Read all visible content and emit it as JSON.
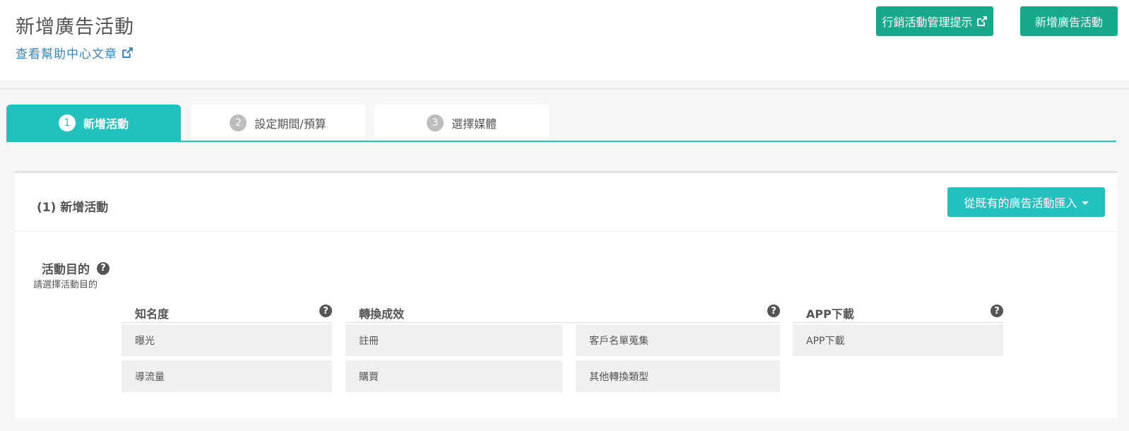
{
  "header": {
    "title": "新增廣告活動",
    "help_link": "查看幫助中心文章",
    "btn_tips": "行銷活動管理提示",
    "btn_new": "新增廣告活動"
  },
  "tabs": [
    {
      "num": "1",
      "label": "新增活動",
      "active": true
    },
    {
      "num": "2",
      "label": "設定期間/預算",
      "active": false
    },
    {
      "num": "3",
      "label": "選擇媒體",
      "active": false
    }
  ],
  "card": {
    "title": "(1) 新增活動",
    "import_label": "從既有的廣告活動匯入",
    "objective_label": "活動目的",
    "objective_hint": "請選擇活動目的"
  },
  "groups": [
    {
      "title": "知名度",
      "options": [
        "曝光",
        "導流量"
      ]
    },
    {
      "title": "轉換成效",
      "options": [
        "註冊",
        "客戶名單蒐集",
        "購買",
        "其他轉換類型"
      ]
    },
    {
      "title": "APP下載",
      "options": [
        "APP下載"
      ]
    }
  ],
  "icons": {
    "external_link": "external-link-icon",
    "help": "question-circle-icon",
    "caret": "caret-down-icon"
  },
  "colors": {
    "primary_green": "#17a98c",
    "teal": "#23c0c0",
    "link_blue": "#3a84b9"
  }
}
